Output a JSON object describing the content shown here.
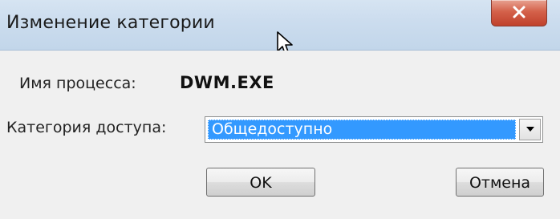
{
  "window": {
    "title": "Изменение категории"
  },
  "process": {
    "label": "Имя процесса:",
    "value": "DWM.EXE"
  },
  "access_category": {
    "label": "Категория доступа:",
    "selected": "Общедоступно"
  },
  "buttons": {
    "ok": "OK",
    "cancel": "Отмена"
  },
  "icons": {
    "close": "close-icon",
    "dropdown": "chevron-down-icon",
    "cursor": "mouse-pointer-icon"
  },
  "colors": {
    "selection": "#3399ff",
    "close_button": "#c7472f",
    "titlebar": "#cbdcee"
  }
}
